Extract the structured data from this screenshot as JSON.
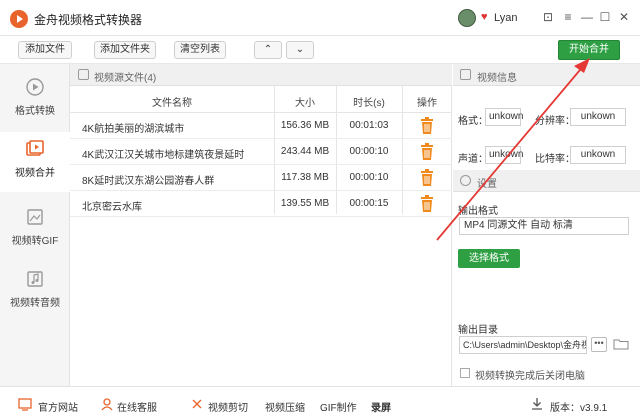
{
  "app": {
    "title": "金舟视频格式转换器",
    "user_name": "Lyan"
  },
  "window_controls": {
    "skin": "⊡",
    "menu": "≡",
    "minimize": "—",
    "maximize": "☐",
    "close": "✕"
  },
  "toolbar": {
    "add_file": "添加文件",
    "add_folder": "添加文件夹",
    "clear_list": "清空列表",
    "up": "⌃",
    "down": "⌄",
    "start_merge": "开始合并"
  },
  "sidebar": {
    "items": [
      {
        "label": "格式转换",
        "icon": "play-circle-icon"
      },
      {
        "label": "视频合并",
        "icon": "merge-icon"
      },
      {
        "label": "视频转GIF",
        "icon": "gif-icon"
      },
      {
        "label": "视频转音频",
        "icon": "music-icon"
      }
    ],
    "active_index": 1
  },
  "files": {
    "header": "视频源文件(4)",
    "columns": [
      "文件名称",
      "大小",
      "时长(s)",
      "操作"
    ],
    "rows": [
      {
        "name": "4K航拍美丽的湖滨城市",
        "size": "156.36 MB",
        "duration": "00:01:03"
      },
      {
        "name": "4K武汉江汉关城市地标建筑夜景延时",
        "size": "243.44 MB",
        "duration": "00:00:10"
      },
      {
        "name": "8K延时武汉东湖公园游春人群",
        "size": "117.38 MB",
        "duration": "00:00:10"
      },
      {
        "name": "北京密云水库",
        "size": "139.55 MB",
        "duration": "00:00:15"
      }
    ]
  },
  "video_info": {
    "header": "视频信息",
    "format_label": "格式：",
    "format_value": "unkown",
    "resolution_label": "分辨率：",
    "resolution_value": "unkown",
    "channel_label": "声道：",
    "channel_value": "unkown",
    "bitrate_label": "比特率：",
    "bitrate_value": "unkown"
  },
  "settings": {
    "header": "设置",
    "output_format_label": "输出格式",
    "output_format_value": "MP4 同源文件 自动 标清",
    "select_format_btn": "选择格式",
    "output_dir_label": "输出目录",
    "output_dir_value": "C:\\Users\\admin\\Desktop\\金舟视",
    "dots": "•••",
    "shutdown_label": "视频转换完成后关闭电脑"
  },
  "footer": {
    "website": "官方网站",
    "support": "在线客服",
    "video_cut": "视频剪切",
    "video_compress": "视频压缩",
    "gif_make": "GIF制作",
    "screen_record": "录屏",
    "version": "版本：v3.9.1"
  },
  "colors": {
    "accent_green": "#2ea043",
    "brand_orange": "#e8642c",
    "annotation_red": "#e53935"
  }
}
